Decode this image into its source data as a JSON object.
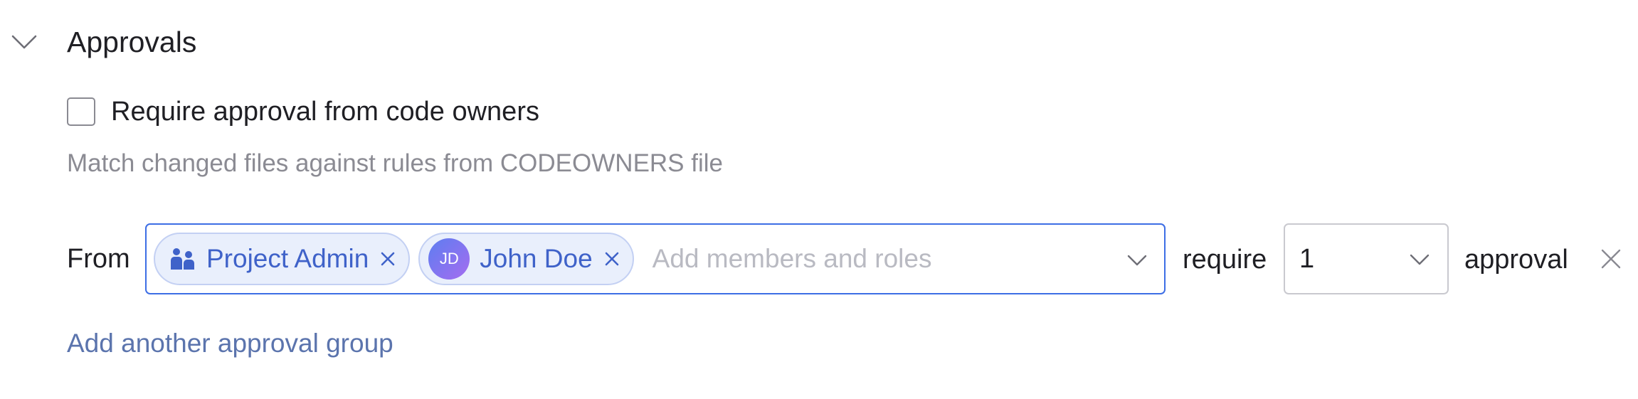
{
  "section": {
    "title": "Approvals"
  },
  "code_owners": {
    "checkbox_label": "Require approval from code owners",
    "checked": false,
    "hint": "Match changed files against rules from CODEOWNERS file"
  },
  "approval_group": {
    "from_label": "From",
    "members": [
      {
        "label": "Project Admin",
        "icon": "team-icon"
      },
      {
        "label": "John Doe",
        "avatar_initials": "JD"
      }
    ],
    "members_placeholder": "Add members and roles",
    "require_label": "require",
    "approval_count": "1",
    "approval_label": "approval"
  },
  "add_group_link": "Add another approval group",
  "colors": {
    "accent": "#3d6ee5",
    "chip_bg": "#e9effc",
    "chip_text": "#3f62c9",
    "link": "#5b74ad",
    "hint": "#8b8b93"
  }
}
